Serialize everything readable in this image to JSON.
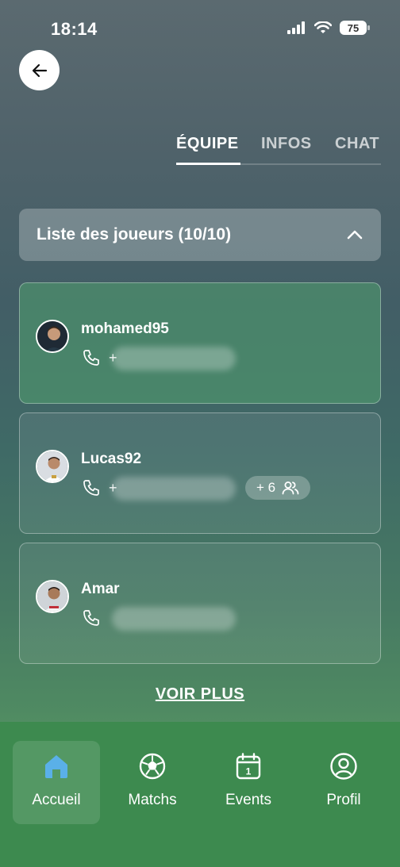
{
  "status_bar": {
    "time": "18:14",
    "battery": "75"
  },
  "tabs": [
    {
      "label": "ÉQUIPE",
      "active": true
    },
    {
      "label": "INFOS",
      "active": false
    },
    {
      "label": "CHAT",
      "active": false
    }
  ],
  "players_section": {
    "title": "Liste des joueurs (10/10)"
  },
  "players": [
    {
      "name": "mohamed95",
      "phone_prefix": "+"
    },
    {
      "name": "Lucas92",
      "phone_prefix": "+",
      "guests": "+ 6"
    },
    {
      "name": "Amar",
      "phone_prefix": ""
    }
  ],
  "see_more": "VOIR PLUS",
  "nav": [
    {
      "label": "Accueil",
      "icon": "home-icon",
      "active": true
    },
    {
      "label": "Matchs",
      "icon": "soccer-ball-icon",
      "active": false
    },
    {
      "label": "Events",
      "icon": "calendar-icon",
      "active": false
    },
    {
      "label": "Profil",
      "icon": "profile-icon",
      "active": false
    }
  ],
  "colors": {
    "nav_bg": "#3d8a4f",
    "active_icon": "#5ab0e8"
  }
}
